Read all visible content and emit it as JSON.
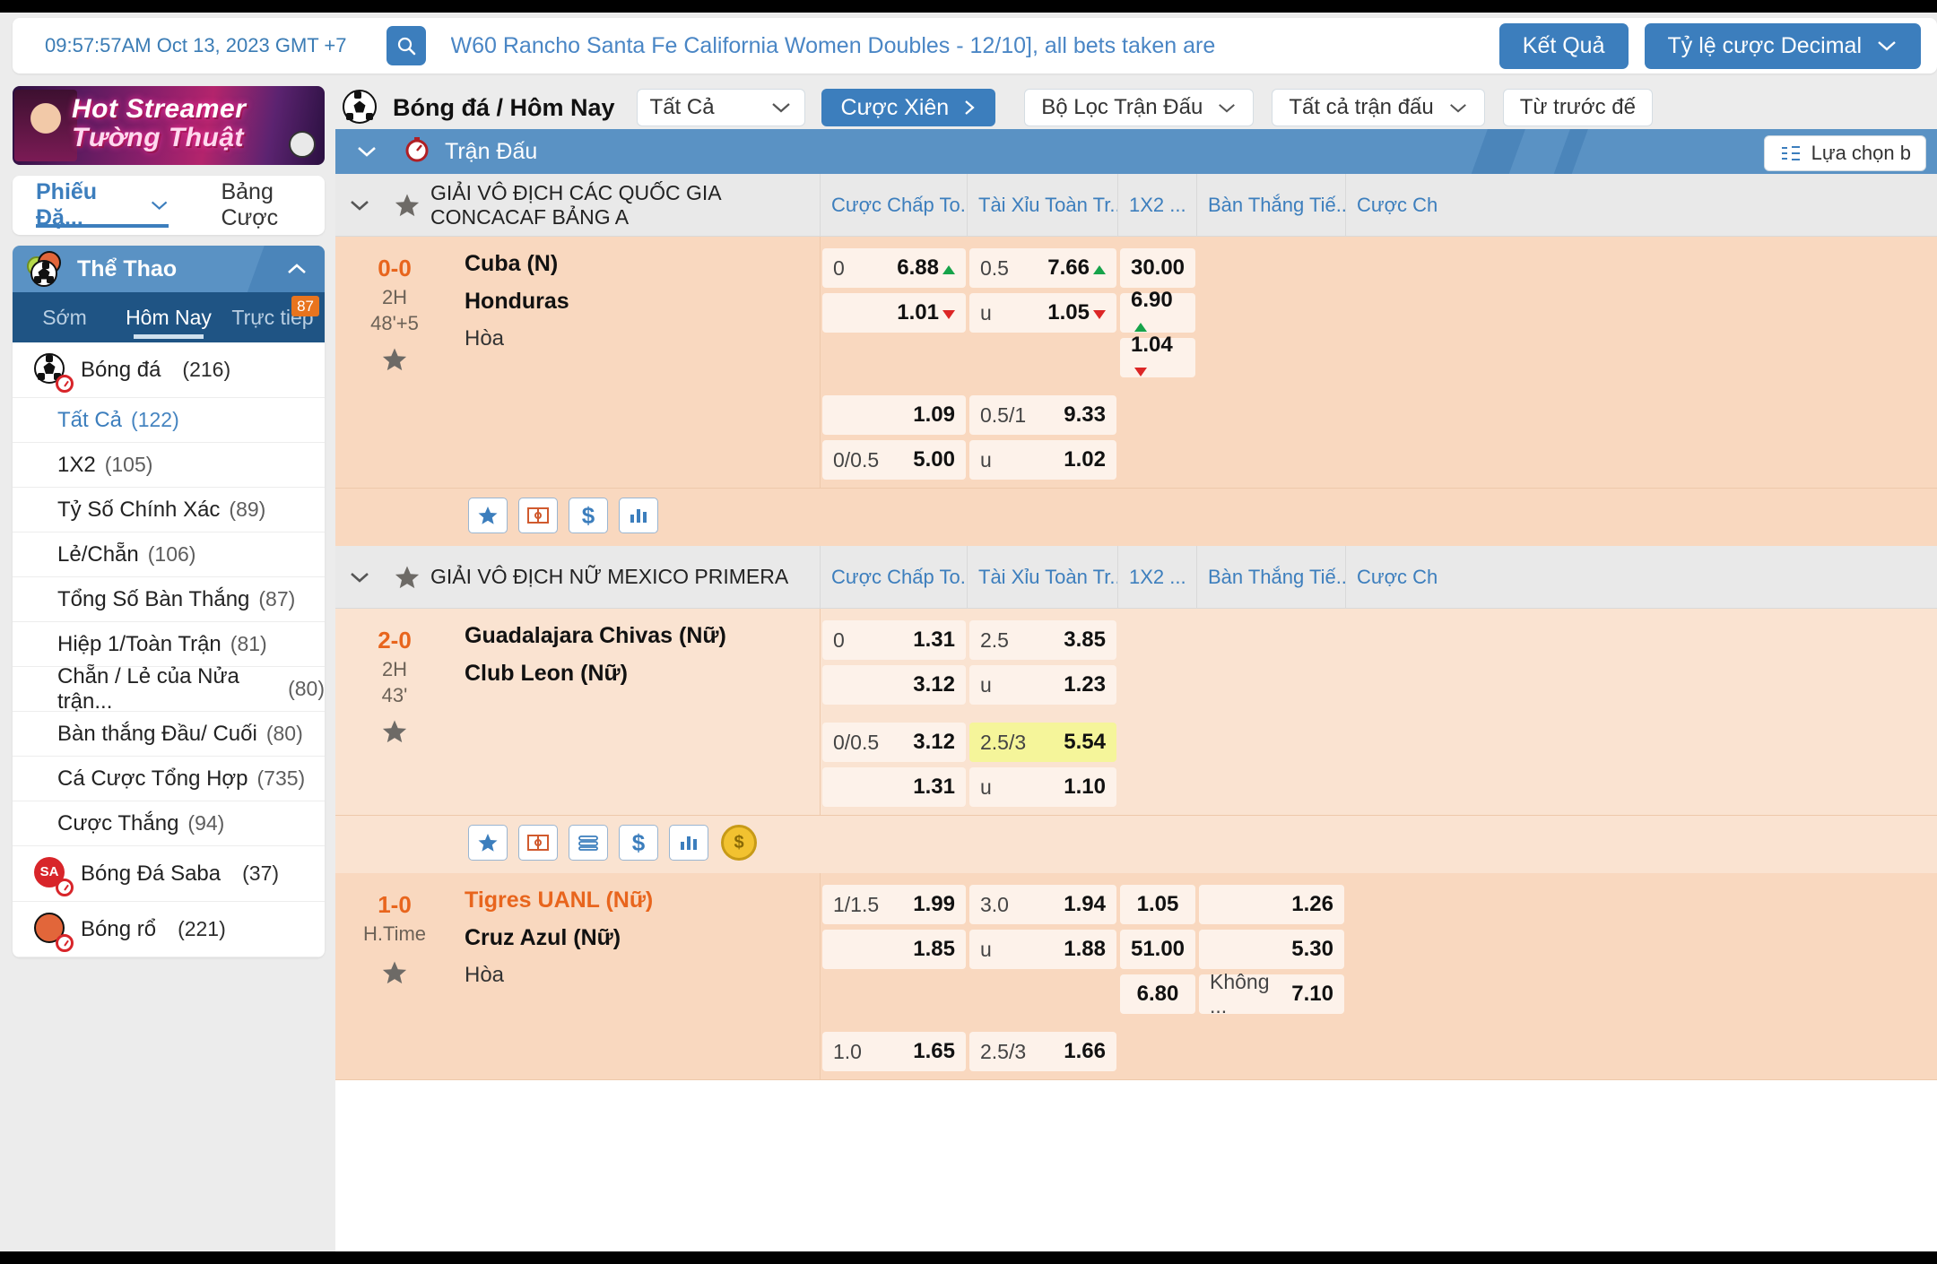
{
  "topbar": {
    "clock": "09:57:57AM Oct 13, 2023 GMT +7",
    "search_icon": "search-icon",
    "marquee": "W60 Rancho Santa Fe California Women Doubles - 12/10], all bets taken are",
    "results_button": "Kết Quả",
    "odds_format": "Tỷ lệ cược Decimal"
  },
  "promo": {
    "line1": "Hot Streamer",
    "line2": "Tường Thuật"
  },
  "betslip": {
    "tab_active": "Phiếu Đặ...",
    "tab_other": "Bảng Cược"
  },
  "sidebar": {
    "header": "Thể Thao",
    "tabs": [
      {
        "label": "Sớm",
        "active": false,
        "badge": ""
      },
      {
        "label": "Hôm Nay",
        "active": true,
        "badge": ""
      },
      {
        "label": "Trực tiếp",
        "active": false,
        "badge": "87"
      }
    ],
    "sports": [
      {
        "label": "Bóng đá",
        "count": "(216)",
        "icon": "soccer-ball-icon"
      },
      {
        "label": "Bóng Đá Saba",
        "count": "(37)",
        "icon": "saba-soccer-icon"
      },
      {
        "label": "Bóng rổ",
        "count": "(221)",
        "icon": "basketball-icon"
      }
    ],
    "markets": [
      {
        "label": "Tất Cả",
        "count": "(122)",
        "active": true
      },
      {
        "label": "1X2",
        "count": "(105)",
        "active": false
      },
      {
        "label": "Tỷ Số Chính Xác",
        "count": "(89)",
        "active": false
      },
      {
        "label": "Lẻ/Chẵn",
        "count": "(106)",
        "active": false
      },
      {
        "label": "Tổng Số Bàn Thắng",
        "count": "(87)",
        "active": false
      },
      {
        "label": "Hiệp 1/Toàn Trận",
        "count": "(81)",
        "active": false
      },
      {
        "label": "Chẵn / Lẻ của Nửa trận...",
        "count": "(80)",
        "active": false
      },
      {
        "label": "Bàn thắng Đầu/ Cuối",
        "count": "(80)",
        "active": false
      },
      {
        "label": "Cá Cược Tổng Hợp",
        "count": "(735)",
        "active": false
      },
      {
        "label": "Cược Thắng",
        "count": "(94)",
        "active": false
      }
    ]
  },
  "nav": {
    "sport_title": "Bóng đá / Hôm Nay",
    "sport_icon": "soccer-ball-icon",
    "league_select": "Tất Cả",
    "parlay_button": "Cược Xiên",
    "filters": [
      "Bộ Lọc Trận Đấu",
      "Tất cả trận đấu",
      "Từ trước đế"
    ]
  },
  "matchbar": {
    "icon": "stopwatch-icon",
    "title": "Trận Đấu",
    "options_button": "Lựa chọn b"
  },
  "columns": [
    "Cược Chấp To...",
    "Tài Xỉu Toàn Tr...",
    "1X2 ...",
    "Bàn Thắng Tiế...",
    "Cược Ch"
  ],
  "leagues": [
    {
      "name": "GIẢI VÔ ĐỊCH CÁC QUỐC GIA CONCACAF BẢNG A",
      "matches": [
        {
          "score": "0-0",
          "period": "2H",
          "minute": "48'+5",
          "home": "Cuba (N)",
          "away": "Honduras",
          "draw": "Hòa",
          "home_orange": false,
          "rows": [
            [
              {
                "hdc": "0",
                "val": "6.88",
                "trend": "up",
                "hl": false
              },
              {
                "hdc": "0.5",
                "val": "7.66",
                "trend": "up",
                "hl": false
              },
              {
                "hdc": "",
                "val": "30.00",
                "trend": "",
                "hl": false
              },
              {
                "hdc": "",
                "val": "",
                "trend": "",
                "hl": false
              },
              {
                "hdc": "",
                "val": "",
                "trend": "",
                "hl": false
              }
            ],
            [
              {
                "hdc": "",
                "val": "1.01",
                "trend": "down",
                "hl": false
              },
              {
                "hdc": "u",
                "val": "1.05",
                "trend": "down",
                "hl": false
              },
              {
                "hdc": "",
                "val": "6.90",
                "trend": "up",
                "hl": false
              },
              {
                "hdc": "",
                "val": "",
                "trend": "",
                "hl": false
              },
              {
                "hdc": "",
                "val": "",
                "trend": "",
                "hl": false
              }
            ],
            [
              {
                "hdc": "",
                "val": "",
                "trend": "",
                "hl": false
              },
              {
                "hdc": "",
                "val": "",
                "trend": "",
                "hl": false
              },
              {
                "hdc": "",
                "val": "1.04",
                "trend": "down",
                "hl": false
              },
              {
                "hdc": "",
                "val": "",
                "trend": "",
                "hl": false
              },
              {
                "hdc": "",
                "val": "",
                "trend": "",
                "hl": false
              }
            ],
            [
              {
                "hdc": "",
                "val": "1.09",
                "trend": "",
                "hl": false
              },
              {
                "hdc": "0.5/1",
                "val": "9.33",
                "trend": "",
                "hl": false
              },
              {
                "hdc": "",
                "val": "",
                "trend": "",
                "hl": false
              },
              {
                "hdc": "",
                "val": "",
                "trend": "",
                "hl": false
              },
              {
                "hdc": "",
                "val": "",
                "trend": "",
                "hl": false
              }
            ],
            [
              {
                "hdc": "0/0.5",
                "val": "5.00",
                "trend": "",
                "hl": false
              },
              {
                "hdc": "u",
                "val": "1.02",
                "trend": "",
                "hl": false
              },
              {
                "hdc": "",
                "val": "",
                "trend": "",
                "hl": false
              },
              {
                "hdc": "",
                "val": "",
                "trend": "",
                "hl": false
              },
              {
                "hdc": "",
                "val": "",
                "trend": "",
                "hl": false
              }
            ]
          ],
          "icons": [
            "star-icon",
            "pitch-icon",
            "dollar-icon",
            "stats-icon"
          ]
        }
      ]
    },
    {
      "name": "GIẢI VÔ ĐỊCH NỮ MEXICO PRIMERA",
      "matches": [
        {
          "score": "2-0",
          "period": "2H",
          "minute": "43'",
          "home": "Guadalajara Chivas (Nữ)",
          "away": "Club Leon (Nữ)",
          "draw": "",
          "home_orange": false,
          "rows": [
            [
              {
                "hdc": "0",
                "val": "1.31",
                "trend": "",
                "hl": false
              },
              {
                "hdc": "2.5",
                "val": "3.85",
                "trend": "",
                "hl": false
              },
              {
                "hdc": "",
                "val": "",
                "trend": "",
                "hl": false
              },
              {
                "hdc": "",
                "val": "",
                "trend": "",
                "hl": false
              },
              {
                "hdc": "",
                "val": "",
                "trend": "",
                "hl": false
              }
            ],
            [
              {
                "hdc": "",
                "val": "3.12",
                "trend": "",
                "hl": false
              },
              {
                "hdc": "u",
                "val": "1.23",
                "trend": "",
                "hl": false
              },
              {
                "hdc": "",
                "val": "",
                "trend": "",
                "hl": false
              },
              {
                "hdc": "",
                "val": "",
                "trend": "",
                "hl": false
              },
              {
                "hdc": "",
                "val": "",
                "trend": "",
                "hl": false
              }
            ],
            [
              {
                "hdc": "0/0.5",
                "val": "3.12",
                "trend": "",
                "hl": false
              },
              {
                "hdc": "2.5/3",
                "val": "5.54",
                "trend": "",
                "hl": true
              },
              {
                "hdc": "",
                "val": "",
                "trend": "",
                "hl": false
              },
              {
                "hdc": "",
                "val": "",
                "trend": "",
                "hl": false
              },
              {
                "hdc": "",
                "val": "",
                "trend": "",
                "hl": false
              }
            ],
            [
              {
                "hdc": "",
                "val": "1.31",
                "trend": "",
                "hl": false
              },
              {
                "hdc": "u",
                "val": "1.10",
                "trend": "",
                "hl": false
              },
              {
                "hdc": "",
                "val": "",
                "trend": "",
                "hl": false
              },
              {
                "hdc": "",
                "val": "",
                "trend": "",
                "hl": false
              },
              {
                "hdc": "",
                "val": "",
                "trend": "",
                "hl": false
              }
            ]
          ],
          "icons": [
            "star-icon",
            "pitch-icon",
            "lines-icon",
            "dollar-icon",
            "stats-icon",
            "coin-icon"
          ]
        },
        {
          "score": "1-0",
          "period": "H.Time",
          "minute": "",
          "home": "Tigres UANL (Nữ)",
          "away": "Cruz Azul (Nữ)",
          "draw": "Hòa",
          "home_orange": true,
          "rows": [
            [
              {
                "hdc": "1/1.5",
                "val": "1.99",
                "trend": "",
                "hl": false
              },
              {
                "hdc": "3.0",
                "val": "1.94",
                "trend": "",
                "hl": false
              },
              {
                "hdc": "",
                "val": "1.05",
                "trend": "",
                "hl": false
              },
              {
                "hdc": "",
                "val": "1.26",
                "trend": "",
                "hl": false
              },
              {
                "hdc": "",
                "val": "",
                "trend": "",
                "hl": false
              }
            ],
            [
              {
                "hdc": "",
                "val": "1.85",
                "trend": "",
                "hl": false
              },
              {
                "hdc": "u",
                "val": "1.88",
                "trend": "",
                "hl": false
              },
              {
                "hdc": "",
                "val": "51.00",
                "trend": "",
                "hl": false
              },
              {
                "hdc": "",
                "val": "5.30",
                "trend": "",
                "hl": false
              },
              {
                "hdc": "",
                "val": "",
                "trend": "",
                "hl": false
              }
            ],
            [
              {
                "hdc": "",
                "val": "",
                "trend": "",
                "hl": false
              },
              {
                "hdc": "",
                "val": "",
                "trend": "",
                "hl": false
              },
              {
                "hdc": "",
                "val": "6.80",
                "trend": "",
                "hl": false
              },
              {
                "hdc": "Không ...",
                "val": "7.10",
                "trend": "",
                "hl": false
              },
              {
                "hdc": "",
                "val": "",
                "trend": "",
                "hl": false
              }
            ],
            [
              {
                "hdc": "1.0",
                "val": "1.65",
                "trend": "",
                "hl": false
              },
              {
                "hdc": "2.5/3",
                "val": "1.66",
                "trend": "",
                "hl": false
              },
              {
                "hdc": "",
                "val": "",
                "trend": "",
                "hl": false
              },
              {
                "hdc": "",
                "val": "",
                "trend": "",
                "hl": false
              },
              {
                "hdc": "",
                "val": "",
                "trend": "",
                "hl": false
              }
            ]
          ],
          "icons": []
        }
      ]
    }
  ],
  "colors": {
    "accent": "#3c7ebd",
    "row_bg": "#f9d8bf",
    "score": "#e8651d",
    "up": "#16a34a",
    "down": "#dc2626",
    "highlight": "#f5f59a"
  }
}
